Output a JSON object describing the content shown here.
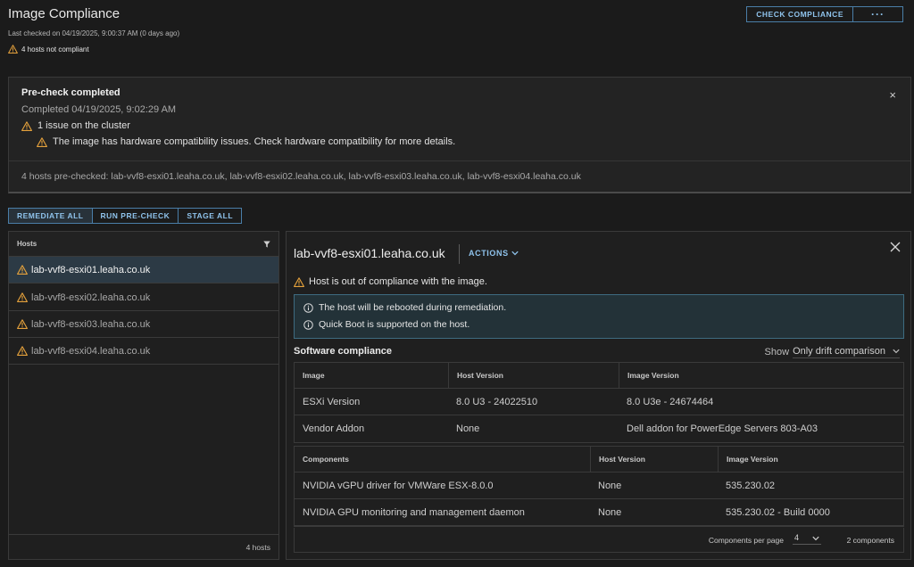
{
  "header": {
    "title": "Image Compliance",
    "last_checked": "Last checked on 04/19/2025, 9:00:37 AM (0 days ago)",
    "not_compliant": "4 hosts not compliant",
    "check_compliance_label": "CHECK COMPLIANCE",
    "more_label": "···"
  },
  "precheck": {
    "title": "Pre-check completed",
    "completed": "Completed 04/19/2025, 9:02:29 AM",
    "issue_summary": "1 issue on the cluster",
    "issue_detail": "The image has hardware compatibility issues. Check hardware compatibility for more details.",
    "close_label": "×",
    "hosts_prechecked": "4 hosts pre-checked: lab-vvf8-esxi01.leaha.co.uk, lab-vvf8-esxi02.leaha.co.uk, lab-vvf8-esxi03.leaha.co.uk, lab-vvf8-esxi04.leaha.co.uk"
  },
  "actions": {
    "remediate_all": "REMEDIATE ALL",
    "run_precheck": "RUN PRE-CHECK",
    "stage_all": "STAGE ALL"
  },
  "hosts": {
    "header": "Hosts",
    "items": [
      {
        "label": "lab-vvf8-esxi01.leaha.co.uk"
      },
      {
        "label": "lab-vvf8-esxi02.leaha.co.uk"
      },
      {
        "label": "lab-vvf8-esxi03.leaha.co.uk"
      },
      {
        "label": "lab-vvf8-esxi04.leaha.co.uk"
      }
    ],
    "count": "4 hosts"
  },
  "detail": {
    "host": "lab-vvf8-esxi01.leaha.co.uk",
    "actions_label": "ACTIONS",
    "status": "Host is out of compliance with the image.",
    "info": [
      "The host will be rebooted during remediation.",
      "Quick Boot is supported on the host."
    ],
    "software_title": "Software compliance",
    "show_label": "Show",
    "show_value": "Only drift comparison",
    "image_table": {
      "headers": [
        "Image",
        "Host Version",
        "Image Version"
      ],
      "rows": [
        [
          "ESXi Version",
          "8.0 U3 - 24022510",
          "8.0 U3e - 24674464"
        ],
        [
          "Vendor Addon",
          "None",
          "Dell addon for PowerEdge Servers 803-A03"
        ]
      ]
    },
    "components_table": {
      "headers": [
        "Components",
        "Host Version",
        "Image Version"
      ],
      "rows": [
        [
          "NVIDIA vGPU driver for VMWare ESX-8.0.0",
          "None",
          "535.230.02"
        ],
        [
          "NVIDIA GPU monitoring and management daemon",
          "None",
          "535.230.02 - Build 0000"
        ]
      ]
    },
    "pager": {
      "per_page_label": "Components per page",
      "per_page_value": "4",
      "total": "2 components"
    }
  },
  "colors": {
    "background": "#1b1b1b",
    "accent": "#8fc3ec",
    "warning": "#e6a23c",
    "selected_row": "#2c3a45"
  }
}
